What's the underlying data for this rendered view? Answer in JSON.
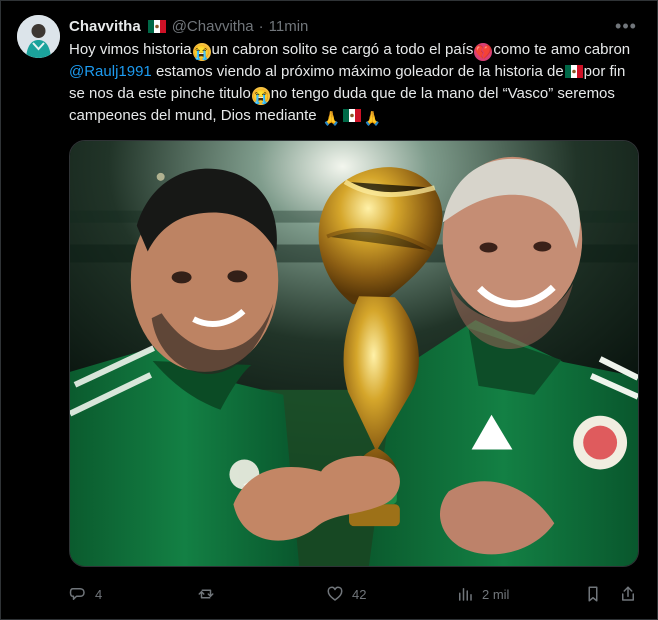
{
  "user": {
    "display_name": "Chavvitha",
    "handle": "@Chavvitha",
    "separator": "·",
    "time": "11min",
    "avatar_icon": "user-avatar"
  },
  "tweet": {
    "text_1": "Hoy vimos historia",
    "text_2": "un cabron solito se cargó a todo el país",
    "text_3": "como te amo cabron ",
    "mention": "@Raulj1991",
    "text_4": " estamos viendo al próximo máximo goleador de la historia de",
    "text_5": "por fin se nos da este pinche titulo",
    "text_6": "no tengo duda que de la mano del “Vasco” seremos campeones del mund, Dios mediante "
  },
  "emoji": {
    "cry": "😭",
    "heart": "💔",
    "pray": "🙏"
  },
  "actions": {
    "reply_count": "4",
    "retweet_count": "",
    "like_count": "42",
    "views_count": "2 mil"
  },
  "colors": {
    "background": "#000000",
    "text": "#e7e9ea",
    "secondary": "#71767b",
    "link": "#1d9bf0",
    "border": "#2f3336"
  }
}
